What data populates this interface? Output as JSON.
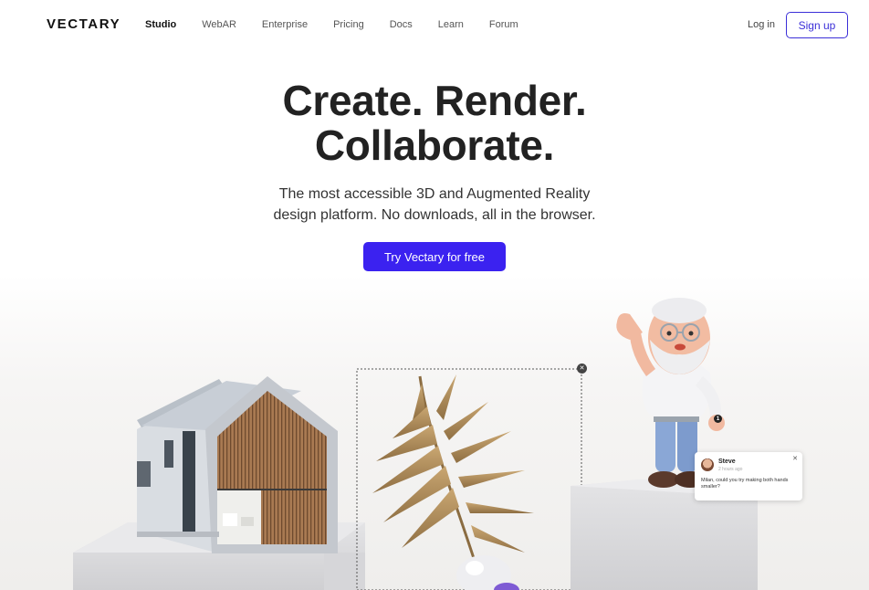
{
  "brand": {
    "logo": "VECTARY"
  },
  "nav": {
    "links": [
      "Studio",
      "WebAR",
      "Enterprise",
      "Pricing",
      "Docs",
      "Learn",
      "Forum"
    ],
    "active": "Studio",
    "login": "Log in",
    "signup": "Sign up"
  },
  "hero": {
    "headline_line1": "Create. Render.",
    "headline_line2": "Collaborate.",
    "subtitle_line1": "The most accessible 3D and Augmented Reality",
    "subtitle_line2": "design platform. No downloads, all in the browser.",
    "cta": "Try Vectary for free"
  },
  "comment": {
    "author": "Steve",
    "time": "2 hours ago",
    "text": "Milan, could you try making both hands smaller?",
    "pin_number": "1"
  },
  "icons": {
    "selection_close": "close-icon",
    "comment_close": "close-icon"
  },
  "colors": {
    "accent": "#3b22f0",
    "signup_border": "#3b2fd8",
    "headline": "#222222"
  }
}
